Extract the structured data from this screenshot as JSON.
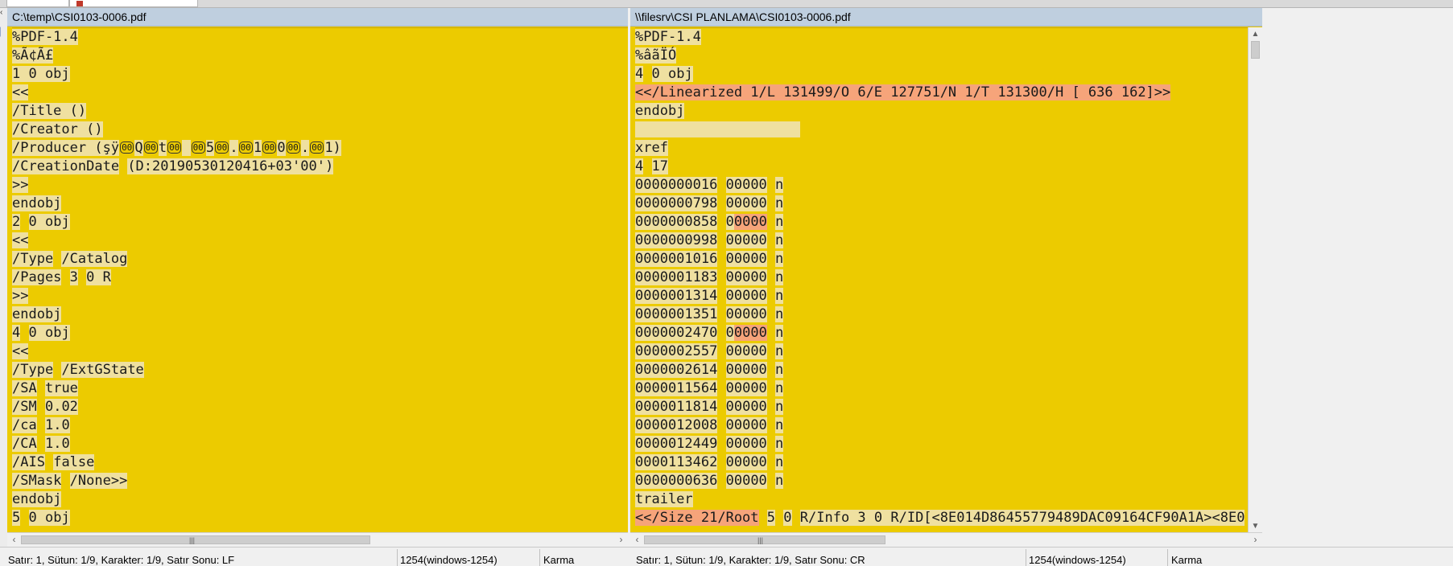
{
  "left_pane": {
    "path": "C:\\temp\\CSI0103-0006.pdf",
    "lines": [
      [
        {
          "t": "%PDF-1.4",
          "c": "hl"
        }
      ],
      [
        {
          "t": "%Ã¢Ã£",
          "c": "hl"
        }
      ],
      [
        {
          "t": "1 0 obj",
          "c": "hl"
        }
      ],
      [
        {
          "t": "<<",
          "c": "hl"
        }
      ],
      [
        {
          "t": "/Title ()",
          "c": "hl"
        }
      ],
      [
        {
          "t": "/Creator ()",
          "c": "hl"
        }
      ],
      [
        {
          "t": "/Producer (şÿ",
          "c": "hl"
        },
        {
          "t": "00",
          "c": "ctl"
        },
        {
          "t": "Q",
          "c": "hl"
        },
        {
          "t": "00",
          "c": "ctl"
        },
        {
          "t": "t",
          "c": "hl"
        },
        {
          "t": "00",
          "c": "ctl"
        },
        {
          "t": " ",
          "c": "hl"
        },
        {
          "t": "00",
          "c": "ctl"
        },
        {
          "t": "5",
          "c": "hl"
        },
        {
          "t": "00",
          "c": "ctl"
        },
        {
          "t": ".",
          "c": "hl"
        },
        {
          "t": "00",
          "c": "ctl"
        },
        {
          "t": "1",
          "c": "hl"
        },
        {
          "t": "00",
          "c": "ctl"
        },
        {
          "t": "0",
          "c": "hl"
        },
        {
          "t": "00",
          "c": "ctl"
        },
        {
          "t": ".",
          "c": "hl"
        },
        {
          "t": "00",
          "c": "ctl"
        },
        {
          "t": "1)",
          "c": "hl"
        }
      ],
      [
        {
          "t": "/CreationDate",
          "c": "hl"
        },
        {
          "t": " ",
          "c": ""
        },
        {
          "t": "(D:20190530120416+03'00')",
          "c": "hl"
        }
      ],
      [
        {
          "t": ">>",
          "c": "hl"
        }
      ],
      [
        {
          "t": "endobj",
          "c": "hl"
        }
      ],
      [
        {
          "t": "2",
          "c": "hl"
        },
        {
          "t": " ",
          "c": ""
        },
        {
          "t": "0 obj",
          "c": "hl"
        }
      ],
      [
        {
          "t": "<<",
          "c": "hl"
        }
      ],
      [
        {
          "t": "/Type",
          "c": "hl"
        },
        {
          "t": " ",
          "c": ""
        },
        {
          "t": "/Catalog",
          "c": "hl"
        }
      ],
      [
        {
          "t": "/Pages",
          "c": "hl"
        },
        {
          "t": " ",
          "c": ""
        },
        {
          "t": "3",
          "c": "hl"
        },
        {
          "t": " ",
          "c": ""
        },
        {
          "t": "0 R",
          "c": "hl"
        }
      ],
      [
        {
          "t": ">>",
          "c": "hl"
        }
      ],
      [
        {
          "t": "endobj",
          "c": "hl"
        }
      ],
      [
        {
          "t": "4",
          "c": "hl"
        },
        {
          "t": " ",
          "c": ""
        },
        {
          "t": "0 obj",
          "c": "hl"
        }
      ],
      [
        {
          "t": "<<",
          "c": "hl"
        }
      ],
      [
        {
          "t": "/Type",
          "c": "hl"
        },
        {
          "t": " ",
          "c": ""
        },
        {
          "t": "/ExtGState",
          "c": "hl"
        }
      ],
      [
        {
          "t": "/SA",
          "c": "hl"
        },
        {
          "t": " ",
          "c": ""
        },
        {
          "t": "true",
          "c": "hl"
        }
      ],
      [
        {
          "t": "/SM",
          "c": "hl"
        },
        {
          "t": " ",
          "c": ""
        },
        {
          "t": "0.02",
          "c": "hl"
        }
      ],
      [
        {
          "t": "/ca",
          "c": "hl"
        },
        {
          "t": " ",
          "c": ""
        },
        {
          "t": "1.0",
          "c": "hl"
        }
      ],
      [
        {
          "t": "/CA",
          "c": "hl"
        },
        {
          "t": " ",
          "c": ""
        },
        {
          "t": "1.0",
          "c": "hl"
        }
      ],
      [
        {
          "t": "/AIS",
          "c": "hl"
        },
        {
          "t": " ",
          "c": ""
        },
        {
          "t": "false",
          "c": "hl"
        }
      ],
      [
        {
          "t": "/SMask",
          "c": "hl"
        },
        {
          "t": " ",
          "c": ""
        },
        {
          "t": "/None>>",
          "c": "hl"
        }
      ],
      [
        {
          "t": "endobj",
          "c": "hl"
        }
      ],
      [
        {
          "t": "5",
          "c": "hl"
        },
        {
          "t": " ",
          "c": ""
        },
        {
          "t": "0 obj",
          "c": "hl"
        }
      ]
    ]
  },
  "right_pane": {
    "path": "\\\\filesrv\\CSI PLANLAMA\\CSI0103-0006.pdf",
    "lines": [
      [
        {
          "t": "%PDF-1.4",
          "c": "hl"
        }
      ],
      [
        {
          "t": "%âãÏÓ",
          "c": "hl"
        }
      ],
      [
        {
          "t": "4",
          "c": "hl"
        },
        {
          "t": " ",
          "c": ""
        },
        {
          "t": "0 obj",
          "c": "hl"
        }
      ],
      [
        {
          "t": "<</Linearized 1/L 131499/O 6/E 127751/N 1/T 131300/H [ 636 162]>>",
          "c": "hr"
        }
      ],
      [
        {
          "t": "endobj",
          "c": "hl"
        }
      ],
      [
        {
          "t": "                    ",
          "c": "hl"
        }
      ],
      [
        {
          "t": "xref",
          "c": "hl"
        }
      ],
      [
        {
          "t": "4",
          "c": "hl"
        },
        {
          "t": " ",
          "c": ""
        },
        {
          "t": "17",
          "c": "hl"
        }
      ],
      [
        {
          "t": "0000000016",
          "c": "hl"
        },
        {
          "t": " ",
          "c": ""
        },
        {
          "t": "00000",
          "c": "hl"
        },
        {
          "t": " ",
          "c": ""
        },
        {
          "t": "n",
          "c": "hl"
        }
      ],
      [
        {
          "t": "0000000798",
          "c": "hl"
        },
        {
          "t": " ",
          "c": ""
        },
        {
          "t": "00000",
          "c": "hl"
        },
        {
          "t": " ",
          "c": ""
        },
        {
          "t": "n",
          "c": "hl"
        }
      ],
      [
        {
          "t": "0000000858",
          "c": "hl"
        },
        {
          "t": " ",
          "c": ""
        },
        {
          "t": "0",
          "c": "hl"
        },
        {
          "t": "0000",
          "c": "hr"
        },
        {
          "t": " ",
          "c": ""
        },
        {
          "t": "n",
          "c": "hl"
        }
      ],
      [
        {
          "t": "0000000998",
          "c": "hl"
        },
        {
          "t": " ",
          "c": ""
        },
        {
          "t": "00000",
          "c": "hl"
        },
        {
          "t": " ",
          "c": ""
        },
        {
          "t": "n",
          "c": "hl"
        }
      ],
      [
        {
          "t": "0000001016",
          "c": "hl"
        },
        {
          "t": " ",
          "c": ""
        },
        {
          "t": "00000",
          "c": "hl"
        },
        {
          "t": " ",
          "c": ""
        },
        {
          "t": "n",
          "c": "hl"
        }
      ],
      [
        {
          "t": "0000001183",
          "c": "hl"
        },
        {
          "t": " ",
          "c": ""
        },
        {
          "t": "00000",
          "c": "hl"
        },
        {
          "t": " ",
          "c": ""
        },
        {
          "t": "n",
          "c": "hl"
        }
      ],
      [
        {
          "t": "0000001314",
          "c": "hl"
        },
        {
          "t": " ",
          "c": ""
        },
        {
          "t": "00000",
          "c": "hl"
        },
        {
          "t": " ",
          "c": ""
        },
        {
          "t": "n",
          "c": "hl"
        }
      ],
      [
        {
          "t": "0000001351",
          "c": "hl"
        },
        {
          "t": " ",
          "c": ""
        },
        {
          "t": "00000",
          "c": "hl"
        },
        {
          "t": " ",
          "c": ""
        },
        {
          "t": "n",
          "c": "hl"
        }
      ],
      [
        {
          "t": "0000002470",
          "c": "hl"
        },
        {
          "t": " ",
          "c": ""
        },
        {
          "t": "0",
          "c": "hl"
        },
        {
          "t": "0000",
          "c": "hr"
        },
        {
          "t": " ",
          "c": ""
        },
        {
          "t": "n",
          "c": "hl"
        }
      ],
      [
        {
          "t": "0000002557",
          "c": "hl"
        },
        {
          "t": " ",
          "c": ""
        },
        {
          "t": "00000",
          "c": "hl"
        },
        {
          "t": " ",
          "c": ""
        },
        {
          "t": "n",
          "c": "hl"
        }
      ],
      [
        {
          "t": "0000002614",
          "c": "hl"
        },
        {
          "t": " ",
          "c": ""
        },
        {
          "t": "00000",
          "c": "hl"
        },
        {
          "t": " ",
          "c": ""
        },
        {
          "t": "n",
          "c": "hl"
        }
      ],
      [
        {
          "t": "0000011564",
          "c": "hl"
        },
        {
          "t": " ",
          "c": ""
        },
        {
          "t": "00000",
          "c": "hl"
        },
        {
          "t": " ",
          "c": ""
        },
        {
          "t": "n",
          "c": "hl"
        }
      ],
      [
        {
          "t": "0000011814",
          "c": "hl"
        },
        {
          "t": " ",
          "c": ""
        },
        {
          "t": "00000",
          "c": "hl"
        },
        {
          "t": " ",
          "c": ""
        },
        {
          "t": "n",
          "c": "hl"
        }
      ],
      [
        {
          "t": "0000012008",
          "c": "hl"
        },
        {
          "t": " ",
          "c": ""
        },
        {
          "t": "00000",
          "c": "hl"
        },
        {
          "t": " ",
          "c": ""
        },
        {
          "t": "n",
          "c": "hl"
        }
      ],
      [
        {
          "t": "0000012449",
          "c": "hl"
        },
        {
          "t": " ",
          "c": ""
        },
        {
          "t": "00000",
          "c": "hl"
        },
        {
          "t": " ",
          "c": ""
        },
        {
          "t": "n",
          "c": "hl"
        }
      ],
      [
        {
          "t": "0000113462",
          "c": "hl"
        },
        {
          "t": " ",
          "c": ""
        },
        {
          "t": "00000",
          "c": "hl"
        },
        {
          "t": " ",
          "c": ""
        },
        {
          "t": "n",
          "c": "hl"
        }
      ],
      [
        {
          "t": "0000000636",
          "c": "hl"
        },
        {
          "t": " ",
          "c": ""
        },
        {
          "t": "00000",
          "c": "hl"
        },
        {
          "t": " ",
          "c": ""
        },
        {
          "t": "n",
          "c": "hl"
        }
      ],
      [
        {
          "t": "trailer",
          "c": "hl"
        }
      ],
      [
        {
          "t": "<</Size 21/Root",
          "c": "hr"
        },
        {
          "t": " ",
          "c": ""
        },
        {
          "t": "5",
          "c": "hl"
        },
        {
          "t": " ",
          "c": ""
        },
        {
          "t": "0",
          "c": "hl"
        },
        {
          "t": " ",
          "c": ""
        },
        {
          "t": "R/Info 3 0 R/ID[<8E014D86455779489DAC09164CF90A1A><8E0",
          "c": "hl"
        }
      ]
    ]
  },
  "status": {
    "left_position": "Satır: 1, Sütun: 1/9, Karakter: 1/9, Satır Sonu: LF",
    "left_encoding": "1254(windows-1254)",
    "left_mode": "Karma",
    "right_position": "Satır: 1, Sütun: 1/9, Karakter: 1/9, Satır Sonu: CR",
    "right_encoding": "1254(windows-1254)",
    "right_mode": "Karma"
  },
  "colors": {
    "pane_background": "#eccb00",
    "line_highlight": "#efe0a0",
    "difference_highlight": "#f6a47a",
    "header_background": "#bfcfdf"
  }
}
